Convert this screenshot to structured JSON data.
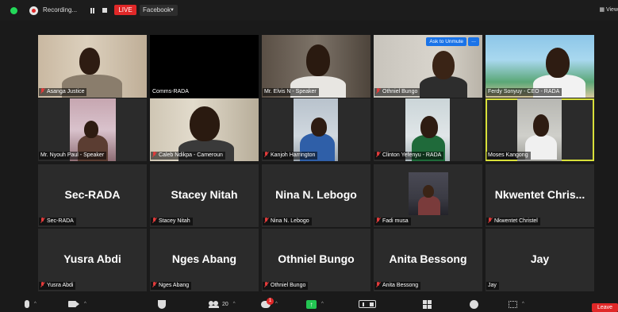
{
  "topbar": {
    "recording_label": "Recording...",
    "live_badge": "LIVE",
    "stream_target": "Facebook",
    "view_label": "View"
  },
  "tiles": [
    {
      "name": "Asanga Justice"
    },
    {
      "name": "Comms-RADA"
    },
    {
      "name": "Mr. Elvis N - Speaker"
    },
    {
      "name": "Othniel Bungo",
      "unmute": "Ask to Unmute",
      "more": "..."
    },
    {
      "name": "Ferdy Sonyuy - CEO - RADA"
    },
    {
      "name": "Mr. Nyouh Paul - Speaker"
    },
    {
      "name": "Caleb Ndikpa - Cameroun"
    },
    {
      "name": "Kanjoh Harrington"
    },
    {
      "name": "Clinton Yefenyu - RADA"
    },
    {
      "name": "Moses Kangong"
    },
    {
      "name": "Sec-RADA",
      "big": "Sec-RADA"
    },
    {
      "name": "Stacey Nitah",
      "big": "Stacey Nitah"
    },
    {
      "name": "Nina N. Lebogo",
      "big": "Nina N. Lebogo"
    },
    {
      "name": "Fadi musa"
    },
    {
      "name": "Nkwentet Christel",
      "big": "Nkwentet Chris..."
    },
    {
      "name": "Yusra Abdi",
      "big": "Yusra Abdi"
    },
    {
      "name": "Nges Abang",
      "big": "Nges Abang"
    },
    {
      "name": "Othniel Bungo",
      "big": "Othniel Bungo"
    },
    {
      "name": "Anita Bessong",
      "big": "Anita Bessong"
    },
    {
      "name": "Jay",
      "big": "Jay"
    }
  ],
  "toolbar": {
    "participants_count": "20",
    "chat_badge": "1",
    "share_glyph": "↑",
    "leave_label": "Leave",
    "caret": "^"
  },
  "colors": {
    "live": "#e02828",
    "active_speaker": "#d8e03a",
    "share": "#23c552",
    "unmute_button": "#1a73e8"
  }
}
